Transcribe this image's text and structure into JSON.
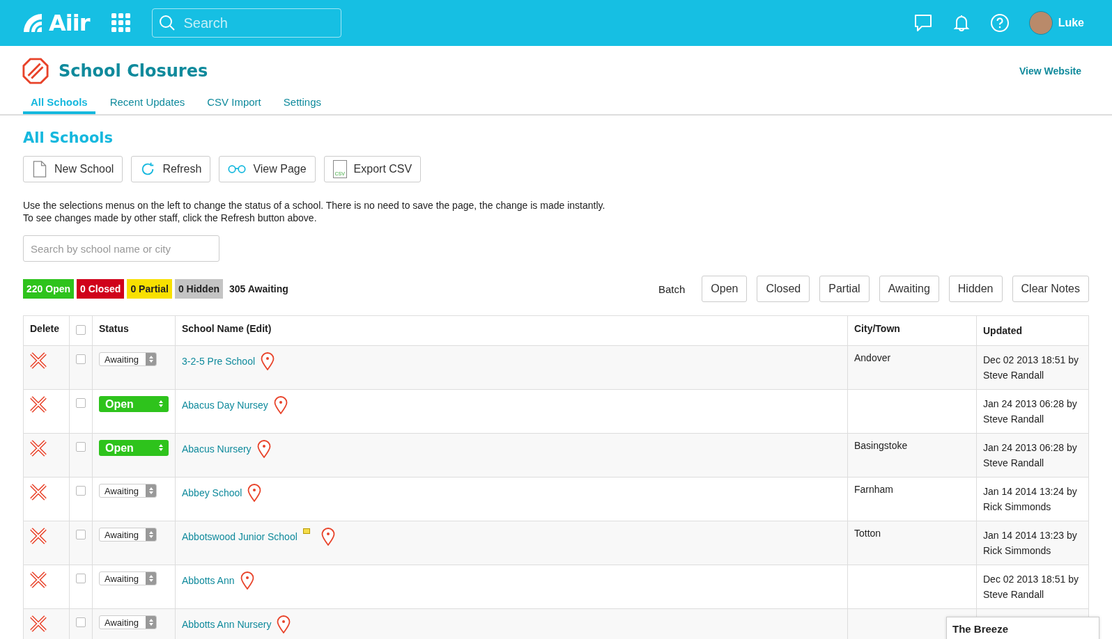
{
  "topbar": {
    "logo": "Aiir",
    "search": {
      "placeholder": "Search"
    },
    "user": "Luke"
  },
  "header": {
    "title": "School Closures",
    "link": "View Website"
  },
  "tabs": [
    {
      "label": "All Schools",
      "selected": true
    },
    {
      "label": "Recent Updates",
      "selected": false
    },
    {
      "label": "CSV Import",
      "selected": false
    },
    {
      "label": "Settings",
      "selected": false
    }
  ],
  "section_title": "All Schools",
  "toolbar": [
    {
      "label": "New School",
      "kind": "page"
    },
    {
      "label": "Refresh",
      "kind": "refresh"
    },
    {
      "label": "View Page",
      "kind": "glasses"
    },
    {
      "label": "Export CSV",
      "kind": "csv",
      "icon_text": "CSV"
    }
  ],
  "help": [
    "Use the selections menus on the left to change the status of a school. There is no need to save the page, the change is made instantly.",
    "To see changes made by other staff, click the Refresh button above."
  ],
  "filter": {
    "placeholder": "Search by school name or city"
  },
  "counts": [
    {
      "label": "220 Open",
      "color": "#2ec31c"
    },
    {
      "label": "0 Closed",
      "color": "#d0021b"
    },
    {
      "label": "0 Partial",
      "color": "#f8e000"
    },
    {
      "label": "0 Hidden",
      "color": "#c4c4c4"
    },
    {
      "label": "305 Awaiting"
    }
  ],
  "batch": {
    "label": "Batch",
    "buttons": [
      "Open",
      "Closed",
      "Partial",
      "Awaiting",
      "Hidden",
      "Clear Notes"
    ]
  },
  "table": {
    "columns": [
      "Delete",
      "Status",
      "School Name (Edit)",
      "City/Town",
      "Updated"
    ],
    "header_checked": false,
    "rows": [
      {
        "checked": false,
        "status": {
          "label": "Awaiting",
          "kind": "awaiting"
        },
        "name": "3-2-5 Pre School",
        "note": false,
        "city": "Andover",
        "updated": [
          "Dec 02 2013 18:51 by",
          "Steve Randall"
        ]
      },
      {
        "checked": false,
        "status": {
          "label": "Open",
          "kind": "open"
        },
        "name": "Abacus Day Nursey",
        "note": false,
        "updated": [
          "Jan 24 2013 06:28 by",
          "Steve Randall"
        ]
      },
      {
        "checked": false,
        "status": {
          "label": "Open",
          "kind": "open"
        },
        "name": "Abacus Nursery",
        "note": false,
        "city": "Basingstoke",
        "updated": [
          "Jan 24 2013 06:28 by",
          "Steve Randall"
        ]
      },
      {
        "checked": false,
        "status": {
          "label": "Awaiting",
          "kind": "awaiting"
        },
        "name": "Abbey School",
        "note": false,
        "city": "Farnham",
        "updated": [
          "Jan 14 2014 13:24 by",
          "Rick Simmonds"
        ]
      },
      {
        "checked": false,
        "status": {
          "label": "Awaiting",
          "kind": "awaiting"
        },
        "name": "Abbotswood Junior School",
        "note": true,
        "city": "Totton",
        "updated": [
          "Jan 14 2014 13:23 by",
          "Rick Simmonds"
        ]
      },
      {
        "checked": false,
        "status": {
          "label": "Awaiting",
          "kind": "awaiting"
        },
        "name": "Abbotts Ann",
        "note": false,
        "updated": [
          "Dec 02 2013 18:51 by",
          "Steve Randall"
        ]
      },
      {
        "checked": false,
        "status": {
          "label": "Awaiting",
          "kind": "awaiting"
        },
        "name": "Abbotts Ann Nursery",
        "note": false
      }
    ]
  },
  "popup": {
    "title": "The Breeze"
  }
}
